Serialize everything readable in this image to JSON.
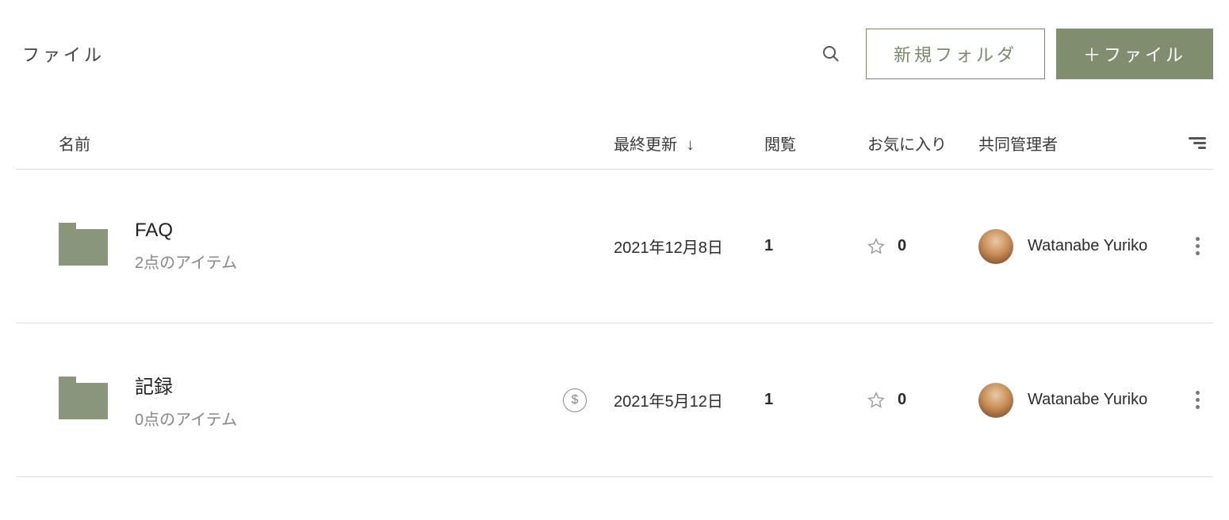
{
  "page": {
    "title": "ファイル"
  },
  "actions": {
    "new_folder": "新規フォルダ",
    "add_file": "＋ファイル"
  },
  "columns": {
    "name": "名前",
    "updated": "最終更新",
    "sort_arrow": "↓",
    "views": "閲覧",
    "favorites": "お気に入り",
    "owner": "共同管理者"
  },
  "rows": [
    {
      "name": "FAQ",
      "subtitle": "2点のアイテム",
      "has_dollar": false,
      "updated": "2021年12月8日",
      "views": "1",
      "favorites": "0",
      "owner": "Watanabe Yuriko"
    },
    {
      "name": "記録",
      "subtitle": "0点のアイテム",
      "has_dollar": true,
      "updated": "2021年5月12日",
      "views": "1",
      "favorites": "0",
      "owner": "Watanabe Yuriko"
    }
  ]
}
